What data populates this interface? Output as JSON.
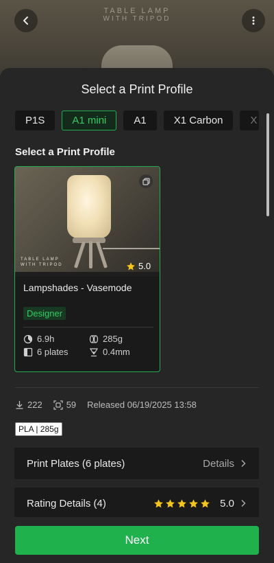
{
  "header": {
    "bg_title_line1": "TABLE LAMP",
    "bg_title_line2": "WITH TRIPOD",
    "back_icon": "chevron-left-icon",
    "more_icon": "more-vertical-icon"
  },
  "sheet": {
    "title": "Select a Print Profile",
    "printer_tabs": [
      {
        "label": "P1S",
        "active": false
      },
      {
        "label": "A1 mini",
        "active": true
      },
      {
        "label": "A1",
        "active": false
      },
      {
        "label": "X1 Carbon",
        "active": false
      },
      {
        "label": "X",
        "active": false
      }
    ],
    "section_title": "Select a Print Profile"
  },
  "profile_card": {
    "image_label_line1": "TABLE LAMP",
    "image_label_line2": "WITH TRIPOD",
    "rating": "5.0",
    "name": "Lampshades - Vasemode",
    "badge": "Designer",
    "print_time": "6.9h",
    "weight": "285g",
    "plates": "6 plates",
    "nozzle": "0.4mm"
  },
  "meta": {
    "downloads": "222",
    "prints": "59",
    "released": "Released 06/19/2025 13:58"
  },
  "filament_tag": "PLA | 285g",
  "rows": {
    "plates_label": "Print Plates (6 plates)",
    "plates_action": "Details",
    "rating_label": "Rating Details (4)",
    "rating_value": "5.0",
    "rating_stars": 5
  },
  "next_button": "Next",
  "colors": {
    "accent": "#1fb24c",
    "star": "#f5c518",
    "sheet_bg": "#262626"
  }
}
